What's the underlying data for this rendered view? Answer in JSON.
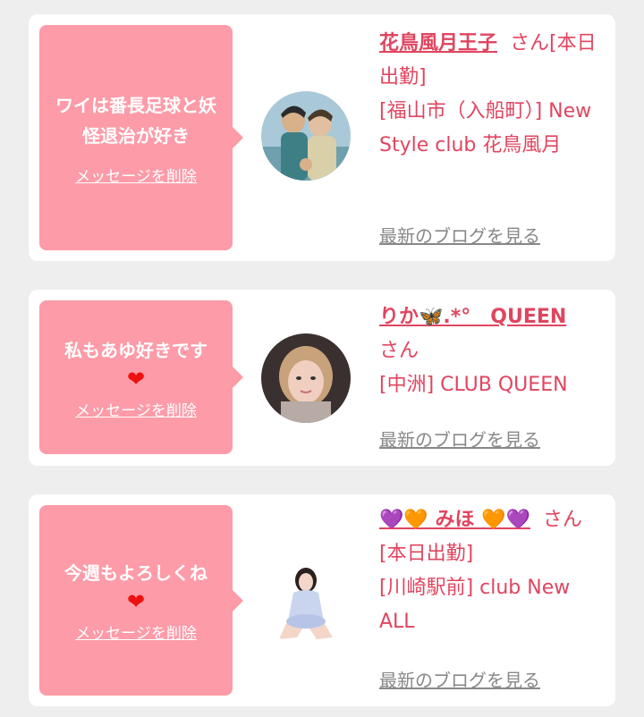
{
  "cards": [
    {
      "message": "ワイは番長足球と妖怪退治が好き",
      "delete_label": "メッセージを削除",
      "name": "花鳥風月王子",
      "suffix": "さん[本日出勤]",
      "location": "[福山市（入船町）] New Style club 花鳥風月",
      "blog_label": "最新のブログを見る",
      "avatar_icon": "illustrated-couple-avatar"
    },
    {
      "message": "私もあゆ好きです",
      "heart": "❤",
      "delete_label": "メッセージを削除",
      "name": "りか🦋.*°　QUEEN",
      "suffix": "さん",
      "location": "[中洲] CLUB QUEEN",
      "blog_label": "最新のブログを見る",
      "avatar_icon": "woman-selfie-avatar"
    },
    {
      "message": "今週もよろしくね",
      "heart": "❤",
      "delete_label": "メッセージを削除",
      "name": "💜🧡 みほ 🧡💜",
      "suffix": "さん[本日出勤]",
      "location": "[川崎駅前] club New ALL",
      "blog_label": "最新のブログを見る",
      "avatar_icon": "woman-seated-avatar"
    }
  ],
  "colors": {
    "bubble": "#fd9ba8",
    "accent_text": "#e0455f",
    "link_gray": "#888888",
    "heart": "#ee1111"
  }
}
